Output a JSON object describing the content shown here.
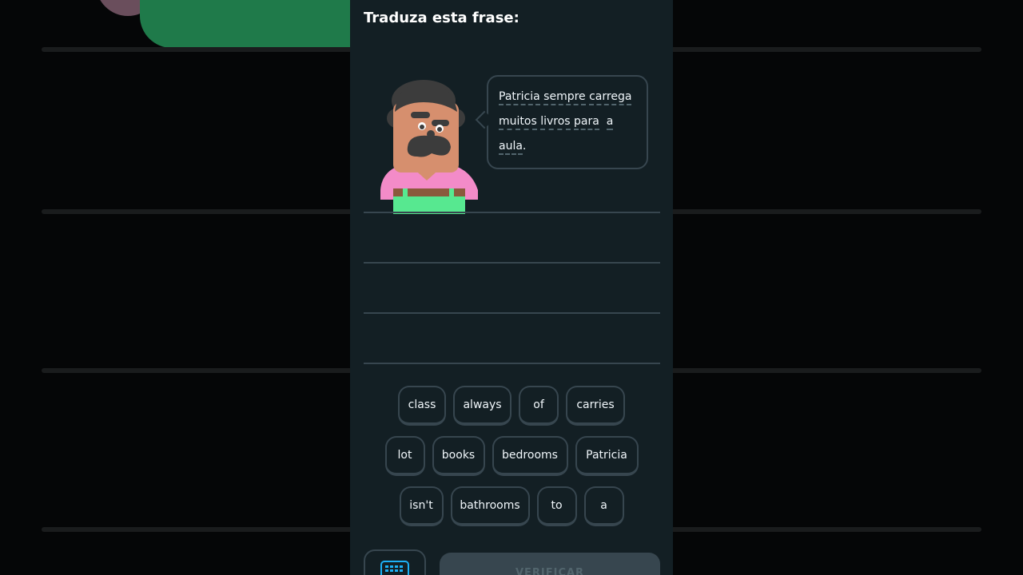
{
  "header": {
    "title": "Traduza esta frase:"
  },
  "prompt": {
    "lines": [
      [
        {
          "text": "Patricia",
          "hint": true
        },
        {
          "text": " ",
          "hint": false
        },
        {
          "text": "sempre",
          "hint": true
        },
        {
          "text": " ",
          "hint": false
        },
        {
          "text": "carrega",
          "hint": true
        }
      ],
      [
        {
          "text": "muitos",
          "hint": true
        },
        {
          "text": " ",
          "hint": false
        },
        {
          "text": "livros",
          "hint": true
        },
        {
          "text": " ",
          "hint": false
        },
        {
          "text": "para",
          "hint": true
        },
        {
          "text": "  ",
          "hint": false
        },
        {
          "text": "a",
          "hint": true
        }
      ],
      [
        {
          "text": "aula",
          "hint": true
        },
        {
          "text": ".",
          "hint": false
        }
      ]
    ]
  },
  "word_bank": [
    [
      "class",
      "always",
      "of",
      "carries"
    ],
    [
      "lot",
      "books",
      "bedrooms",
      "Patricia"
    ],
    [
      "isn't",
      "bathrooms",
      "to",
      "a"
    ]
  ],
  "footer": {
    "keyboard_icon": "keyboard-icon",
    "verify_label": "VERIFICAR"
  },
  "colors": {
    "background": "#131f24",
    "border": "#37464f",
    "text": "#f1f7fb",
    "character_skin": "#d68f6e",
    "character_shirt": "#f38bc8",
    "character_pants": "#57e890"
  }
}
